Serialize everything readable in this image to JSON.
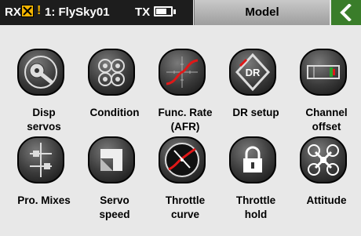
{
  "status": {
    "rx_label": "RX",
    "alarm_mark": "!",
    "model_name": "1: FlySky01",
    "tx_label": "TX",
    "tx_battery_level": 0.7
  },
  "header": {
    "title": "Model",
    "back_icon": "back-arrow-icon"
  },
  "colors": {
    "accent_green": "#3a7d2a",
    "warning": "#f2b400",
    "curve_red": "#e01818"
  },
  "functions": [
    {
      "icon": "disp-servos-icon",
      "line1": "Disp",
      "line2": "servos"
    },
    {
      "icon": "condition-icon",
      "line1": "Condition",
      "line2": ""
    },
    {
      "icon": "func-rate-icon",
      "line1": "Func. Rate",
      "line2": "(AFR)"
    },
    {
      "icon": "dr-setup-icon",
      "line1": "DR setup",
      "line2": "",
      "icon_text": "DR"
    },
    {
      "icon": "channel-offset-icon",
      "line1": "Channel",
      "line2": "offset"
    },
    {
      "icon": "pro-mixes-icon",
      "line1": "Pro. Mixes",
      "line2": ""
    },
    {
      "icon": "servo-speed-icon",
      "line1": "Servo",
      "line2": "speed"
    },
    {
      "icon": "throttle-curve-icon",
      "line1": "Throttle",
      "line2": "curve"
    },
    {
      "icon": "throttle-hold-icon",
      "line1": "Throttle",
      "line2": "hold"
    },
    {
      "icon": "attitude-icon",
      "line1": "Attitude",
      "line2": ""
    }
  ]
}
